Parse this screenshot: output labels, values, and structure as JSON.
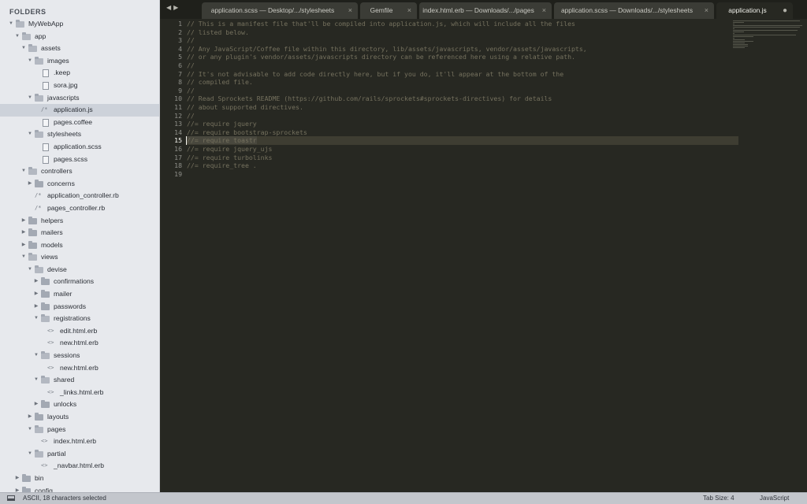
{
  "sidebar": {
    "header": "FOLDERS",
    "items": [
      {
        "label": "MyWebApp",
        "type": "folder",
        "depth": 0,
        "expanded": true,
        "icon": "folder-open-icon"
      },
      {
        "label": "app",
        "type": "folder",
        "depth": 1,
        "expanded": true,
        "icon": "folder-open-icon"
      },
      {
        "label": "assets",
        "type": "folder",
        "depth": 2,
        "expanded": true,
        "icon": "folder-open-icon"
      },
      {
        "label": "images",
        "type": "folder",
        "depth": 3,
        "expanded": true,
        "icon": "folder-open-icon"
      },
      {
        "label": ".keep",
        "type": "file",
        "depth": 4,
        "icon": "file-icon"
      },
      {
        "label": "sora.jpg",
        "type": "file",
        "depth": 4,
        "icon": "file-icon"
      },
      {
        "label": "javascripts",
        "type": "folder",
        "depth": 3,
        "expanded": true,
        "icon": "folder-open-icon"
      },
      {
        "label": "application.js",
        "type": "code",
        "depth": 4,
        "icon": "comment-code-icon",
        "glyph": "/*",
        "selected": true
      },
      {
        "label": "pages.coffee",
        "type": "file",
        "depth": 4,
        "icon": "file-icon"
      },
      {
        "label": "stylesheets",
        "type": "folder",
        "depth": 3,
        "expanded": true,
        "icon": "folder-open-icon"
      },
      {
        "label": "application.scss",
        "type": "file",
        "depth": 4,
        "icon": "file-icon"
      },
      {
        "label": "pages.scss",
        "type": "file",
        "depth": 4,
        "icon": "file-icon"
      },
      {
        "label": "controllers",
        "type": "folder",
        "depth": 2,
        "expanded": true,
        "icon": "folder-open-icon"
      },
      {
        "label": "concerns",
        "type": "folder",
        "depth": 3,
        "expanded": false,
        "icon": "folder-icon"
      },
      {
        "label": "application_controller.rb",
        "type": "code",
        "depth": 3,
        "icon": "comment-code-icon",
        "glyph": "/*"
      },
      {
        "label": "pages_controller.rb",
        "type": "code",
        "depth": 3,
        "icon": "comment-code-icon",
        "glyph": "/*"
      },
      {
        "label": "helpers",
        "type": "folder",
        "depth": 2,
        "expanded": false,
        "icon": "folder-icon"
      },
      {
        "label": "mailers",
        "type": "folder",
        "depth": 2,
        "expanded": false,
        "icon": "folder-icon"
      },
      {
        "label": "models",
        "type": "folder",
        "depth": 2,
        "expanded": false,
        "icon": "folder-icon"
      },
      {
        "label": "views",
        "type": "folder",
        "depth": 2,
        "expanded": true,
        "icon": "folder-open-icon"
      },
      {
        "label": "devise",
        "type": "folder",
        "depth": 3,
        "expanded": true,
        "icon": "folder-open-icon"
      },
      {
        "label": "confirmations",
        "type": "folder",
        "depth": 4,
        "expanded": false,
        "icon": "folder-icon"
      },
      {
        "label": "mailer",
        "type": "folder",
        "depth": 4,
        "expanded": false,
        "icon": "folder-icon"
      },
      {
        "label": "passwords",
        "type": "folder",
        "depth": 4,
        "expanded": false,
        "icon": "folder-icon"
      },
      {
        "label": "registrations",
        "type": "folder",
        "depth": 4,
        "expanded": true,
        "icon": "folder-open-icon"
      },
      {
        "label": "edit.html.erb",
        "type": "code",
        "depth": 5,
        "icon": "html-code-icon",
        "glyph": "<>"
      },
      {
        "label": "new.html.erb",
        "type": "code",
        "depth": 5,
        "icon": "html-code-icon",
        "glyph": "<>"
      },
      {
        "label": "sessions",
        "type": "folder",
        "depth": 4,
        "expanded": true,
        "icon": "folder-open-icon"
      },
      {
        "label": "new.html.erb",
        "type": "code",
        "depth": 5,
        "icon": "html-code-icon",
        "glyph": "<>"
      },
      {
        "label": "shared",
        "type": "folder",
        "depth": 4,
        "expanded": true,
        "icon": "folder-open-icon"
      },
      {
        "label": "_links.html.erb",
        "type": "code",
        "depth": 5,
        "icon": "html-code-icon",
        "glyph": "<>"
      },
      {
        "label": "unlocks",
        "type": "folder",
        "depth": 4,
        "expanded": false,
        "icon": "folder-icon"
      },
      {
        "label": "layouts",
        "type": "folder",
        "depth": 3,
        "expanded": false,
        "icon": "folder-icon"
      },
      {
        "label": "pages",
        "type": "folder",
        "depth": 3,
        "expanded": true,
        "icon": "folder-open-icon"
      },
      {
        "label": "index.html.erb",
        "type": "code",
        "depth": 4,
        "icon": "html-code-icon",
        "glyph": "<>"
      },
      {
        "label": "partial",
        "type": "folder",
        "depth": 3,
        "expanded": true,
        "icon": "folder-open-icon"
      },
      {
        "label": "_navbar.html.erb",
        "type": "code",
        "depth": 4,
        "icon": "html-code-icon",
        "glyph": "<>"
      },
      {
        "label": "bin",
        "type": "folder",
        "depth": 1,
        "expanded": false,
        "icon": "folder-icon"
      },
      {
        "label": "config",
        "type": "folder",
        "depth": 1,
        "expanded": false,
        "icon": "folder-icon"
      }
    ]
  },
  "tabbar": {
    "nav_back": "◀",
    "nav_forward": "▶",
    "tabs": [
      {
        "label": "application.scss — Desktop/.../stylesheets",
        "close": "×",
        "active": false
      },
      {
        "label": "Gemfile",
        "close": "×",
        "active": false
      },
      {
        "label": "index.html.erb — Downloads/.../pages",
        "close": "×",
        "active": false
      },
      {
        "label": "application.scss — Downloads/.../stylesheets",
        "close": "×",
        "active": false
      },
      {
        "label": "application.js",
        "close": "●",
        "active": true
      }
    ]
  },
  "editor": {
    "current_line": 15,
    "lines": [
      {
        "n": "1",
        "text": "// This is a manifest file that'll be compiled into application.js, which will include all the files"
      },
      {
        "n": "2",
        "text": "// listed below."
      },
      {
        "n": "3",
        "text": "//"
      },
      {
        "n": "4",
        "text": "// Any JavaScript/Coffee file within this directory, lib/assets/javascripts, vendor/assets/javascripts,"
      },
      {
        "n": "5",
        "text": "// or any plugin's vendor/assets/javascripts directory can be referenced here using a relative path."
      },
      {
        "n": "6",
        "text": "//"
      },
      {
        "n": "7",
        "text": "// It's not advisable to add code directly here, but if you do, it'll appear at the bottom of the"
      },
      {
        "n": "8",
        "text": "// compiled file."
      },
      {
        "n": "9",
        "text": "//"
      },
      {
        "n": "10",
        "text": "// Read Sprockets README (https://github.com/rails/sprockets#sprockets-directives) for details"
      },
      {
        "n": "11",
        "text": "// about supported directives."
      },
      {
        "n": "12",
        "text": "//"
      },
      {
        "n": "13",
        "text": "//= require jquery"
      },
      {
        "n": "14",
        "text": "//= require bootstrap-sprockets"
      },
      {
        "n": "15",
        "text": "//= require toastr"
      },
      {
        "n": "16",
        "text": "//= require jquery_ujs"
      },
      {
        "n": "17",
        "text": "//= require turbolinks"
      },
      {
        "n": "18",
        "text": "//= require_tree ."
      },
      {
        "n": "19",
        "text": ""
      }
    ]
  },
  "statusbar": {
    "selection": "ASCII, 18 characters selected",
    "tab_size": "Tab Size: 4",
    "syntax": "JavaScript"
  },
  "colors": {
    "editor_bg": "#272822",
    "comment": "#75715e",
    "sidebar_bg": "#e7e9ed",
    "tab_active_bg": "#272822",
    "tab_inactive_bg": "#3b3c36",
    "statusbar_bg": "#c3c6cc"
  }
}
